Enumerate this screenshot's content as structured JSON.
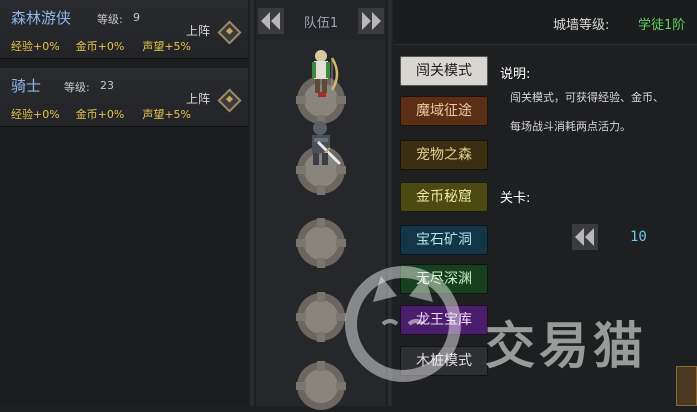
{
  "heroes": [
    {
      "name": "森林游侠",
      "level_label": "等级:",
      "level": "9",
      "deploy_label": "上阵",
      "exp": "经验+0%",
      "gold": "金币+0%",
      "fame": "声望+5%"
    },
    {
      "name": "骑士",
      "level_label": "等级:",
      "level": "23",
      "deploy_label": "上阵",
      "exp": "经验+0%",
      "gold": "金币+0%",
      "fame": "声望+5%"
    }
  ],
  "team": {
    "title": "队伍1",
    "prev_icon": "double-chevron-left-icon",
    "next_icon": "double-chevron-right-icon"
  },
  "wall": {
    "label": "城墙等级:",
    "value": "学徒1阶"
  },
  "modes": [
    {
      "label": "闯关模式",
      "color": "#d8d6d0",
      "text_color": "#1b1b1b"
    },
    {
      "label": "魔域征途",
      "color": "#5a2f16",
      "text_color": "#e8c8a0"
    },
    {
      "label": "宠物之森",
      "color": "#3a2f10",
      "text_color": "#e0d090"
    },
    {
      "label": "金币秘窟",
      "color": "#4a4a12",
      "text_color": "#f0e8a0"
    },
    {
      "label": "宝石矿洞",
      "color": "#123548",
      "text_color": "#b8e0f0"
    },
    {
      "label": "无尽深渊",
      "color": "#16401e",
      "text_color": "#c8f0c0"
    },
    {
      "label": "龙王宝库",
      "color": "#4a1e6a",
      "text_color": "#f0d8ff"
    },
    {
      "label": "木桩模式",
      "color": "#2e2f33",
      "text_color": "#e0e0e0"
    }
  ],
  "description": {
    "title": "说明:",
    "line1": "闯关模式，可获得经验、金币、",
    "line2": "每场战斗消耗两点活力。"
  },
  "stage": {
    "label": "关卡:",
    "value": "10",
    "prev_icon": "double-chevron-left-icon"
  },
  "watermark": {
    "text": "交易猫"
  }
}
